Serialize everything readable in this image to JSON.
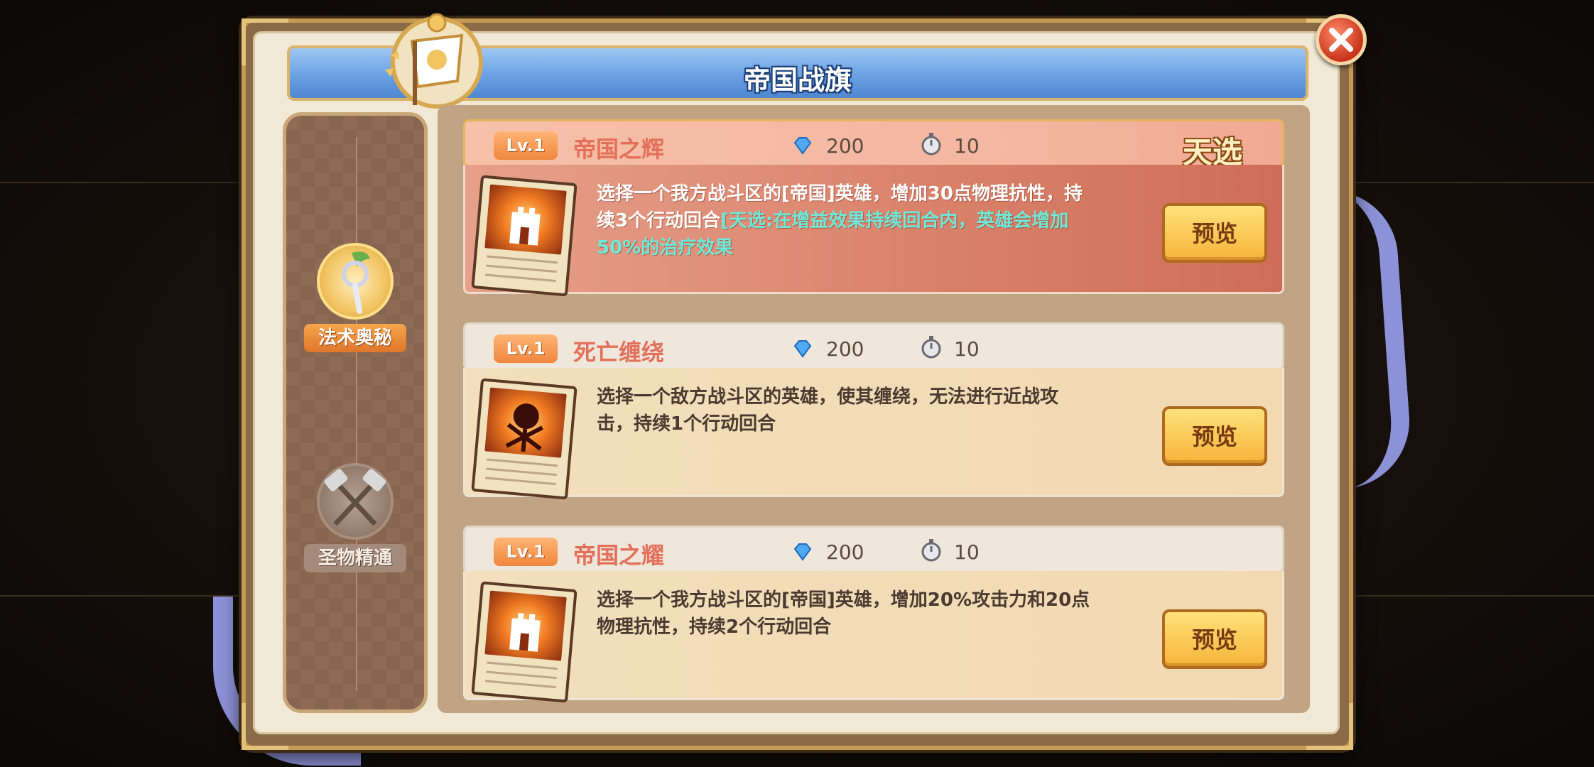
{
  "window": {
    "title": "帝国战旗"
  },
  "sidebar": {
    "items": [
      {
        "label": "法术奥秘",
        "icon": "spell-wand-icon",
        "active": true
      },
      {
        "label": "圣物精通",
        "icon": "crossed-hammers-icon",
        "active": false
      }
    ]
  },
  "cards": [
    {
      "level": "Lv.1",
      "name": "帝国之辉",
      "cost": "200",
      "turns": "10",
      "tag": "天选",
      "desc_main": "选择一个我方战斗区的[帝国]英雄，增加30点物理抗性，持续3个行动回合",
      "desc_highlight": "[天选:在增益效果持续回合内，英雄会增加50%的治疗效果",
      "preview_label": "预览",
      "art_icon": "castle-icon"
    },
    {
      "level": "Lv.1",
      "name": "死亡缠绕",
      "cost": "200",
      "turns": "10",
      "desc_main": "选择一个敌方战斗区的英雄，使其缠绕，无法进行近战攻击，持续1个行动回合",
      "preview_label": "预览",
      "art_icon": "dark-orb-icon"
    },
    {
      "level": "Lv.1",
      "name": "帝国之耀",
      "cost": "200",
      "turns": "10",
      "desc_main": "选择一个我方战斗区的[帝国]英雄，增加20%攻击力和20点物理抗性，持续2个行动回合",
      "preview_label": "预览",
      "art_icon": "castle-icon"
    }
  ],
  "colors": {
    "accent": "#f0863e",
    "title_bar": "#6aa1e3",
    "highlight_text": "#6fe8d8",
    "card_name": "#e2705a"
  }
}
